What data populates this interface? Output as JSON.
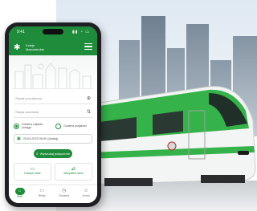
{
  "colors": {
    "brand_green": "#1e8c3a",
    "phone_frame": "#1d1f22"
  },
  "status_bar": {
    "time": "9:41",
    "icons": "▮▮ ◔ ▭"
  },
  "app": {
    "brand_line1": "Koleje",
    "brand_line2": "Mazowieckie",
    "logo_icon": "km-logo-icon",
    "menu_icon": "hamburger-icon"
  },
  "form": {
    "from_label": "Stacja początkowa",
    "to_label": "Stacja docelowa",
    "swap_icon": "swap-arrows-icon",
    "option_departure": "Godzina odjazdu pociągu",
    "option_arrival": "Godzina przyjazdu",
    "date_value": "25.04.2023 06:00 (dzisiaj)",
    "search_button": "Wyszukaj połączenie"
  },
  "cards": [
    {
      "label": "Kolejne dane",
      "icon": "ticket-icon"
    },
    {
      "label": "Wszystkie dane",
      "icon": "route-icon"
    }
  ],
  "tabs": [
    {
      "label": "Start",
      "icon": "home-icon",
      "active": true
    },
    {
      "label": "Bilety",
      "icon": "ticket-icon",
      "active": false
    },
    {
      "label": "Rozkład",
      "icon": "schedule-icon",
      "active": false
    },
    {
      "label": "Konto",
      "icon": "account-icon",
      "active": false
    }
  ]
}
